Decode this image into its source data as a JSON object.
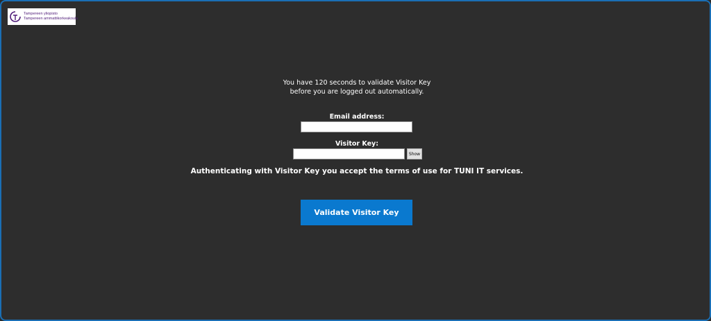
{
  "logo": {
    "line1": "Tampereen yliopisto",
    "line2": "Tampereen ammattikorkeakoulu",
    "icon": "tuni-logo-icon"
  },
  "notice": {
    "line1": "You have 120 seconds to validate Visitor Key",
    "line2": "before you are logged out automatically."
  },
  "form": {
    "email_label": "Email address:",
    "email_value": "",
    "visitor_key_label": "Visitor Key:",
    "visitor_key_value": "",
    "show_label": "Show"
  },
  "terms_text": "Authenticating with Visitor Key you accept the terms of use for TUNI IT services.",
  "validate_label": "Validate Visitor Key",
  "colors": {
    "background": "#2d2d2d",
    "window_border": "#1a6fb5",
    "button": "#0a79cf",
    "logo_text": "#4e1a78"
  }
}
